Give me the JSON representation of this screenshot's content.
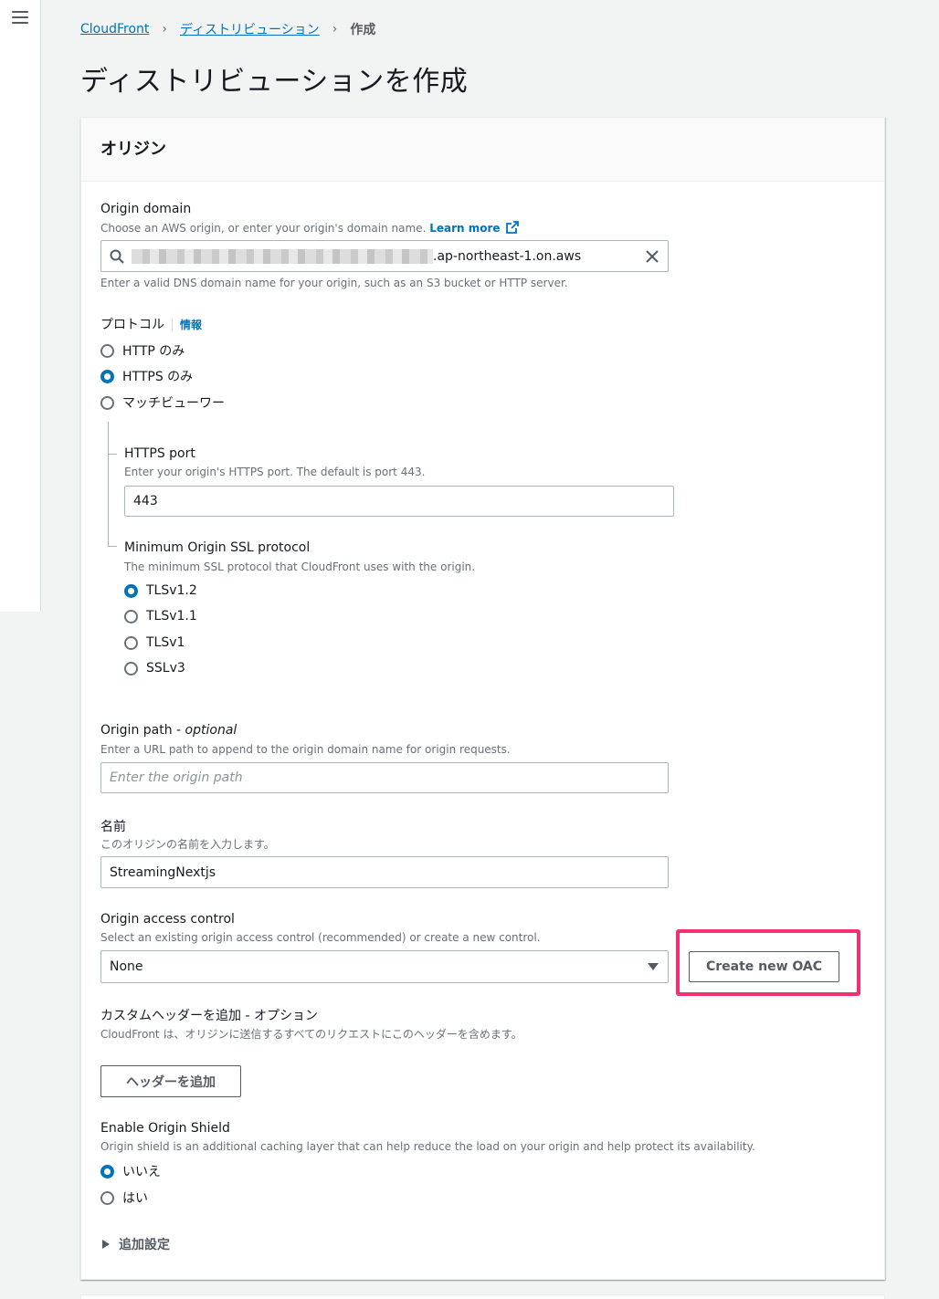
{
  "breadcrumb": {
    "root": "CloudFront",
    "parent": "ディストリビューション",
    "current": "作成"
  },
  "page_title": "ディストリビューションを作成",
  "panel": {
    "title": "オリジン"
  },
  "origin_domain": {
    "label": "Origin domain",
    "description": "Choose an AWS origin, or enter your origin's domain name.",
    "learn_more": "Learn more",
    "value_suffix": ".ap-northeast-1.on.aws",
    "hint": "Enter a valid DNS domain name for your origin, such as an S3 bucket or HTTP server."
  },
  "protocol": {
    "label": "プロトコル",
    "info": "情報",
    "options": [
      "HTTP のみ",
      "HTTPS のみ",
      "マッチビューワー"
    ],
    "selected": "HTTPS のみ"
  },
  "https_port": {
    "label": "HTTPS port",
    "description": "Enter your origin's HTTPS port. The default is port 443.",
    "value": "443"
  },
  "min_ssl": {
    "label": "Minimum Origin SSL protocol",
    "description": "The minimum SSL protocol that CloudFront uses with the origin.",
    "options": [
      "TLSv1.2",
      "TLSv1.1",
      "TLSv1",
      "SSLv3"
    ],
    "selected": "TLSv1.2"
  },
  "origin_path": {
    "label": "Origin path - ",
    "label_optional": "optional",
    "description": "Enter a URL path to append to the origin domain name for origin requests.",
    "placeholder": "Enter the origin path"
  },
  "name": {
    "label": "名前",
    "description": "このオリジンの名前を入力します。",
    "value": "StreamingNextjs"
  },
  "oac": {
    "label": "Origin access control",
    "description": "Select an existing origin access control (recommended) or create a new control.",
    "value": "None",
    "create_button": "Create new OAC"
  },
  "custom_header": {
    "label": "カスタムヘッダーを追加 - オプション",
    "description": "CloudFront は、オリジンに送信するすべてのリクエストにこのヘッダーを含めます。",
    "add_button": "ヘッダーを追加"
  },
  "origin_shield": {
    "label": "Enable Origin Shield",
    "description": "Origin shield is an additional caching layer that can help reduce the load on your origin and help protect its availability.",
    "options": [
      "いいえ",
      "はい"
    ],
    "selected": "いいえ"
  },
  "additional_settings": "追加設定",
  "colors": {
    "accent": "#0073bb",
    "highlight": "#f5306f"
  }
}
